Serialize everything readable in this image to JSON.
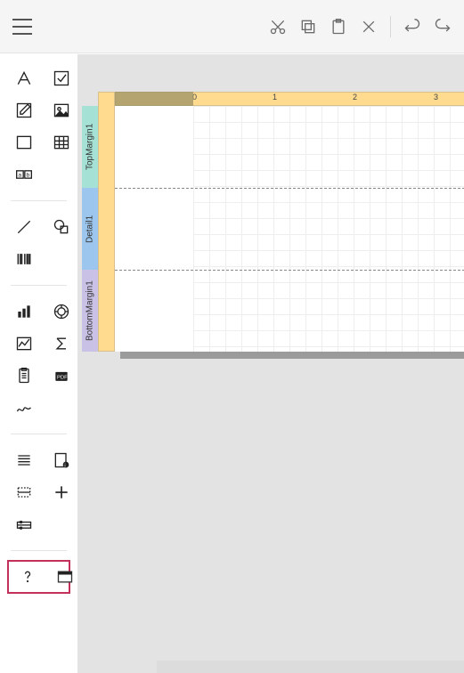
{
  "toolbar": {
    "cut": "Cut",
    "copy": "Copy",
    "paste": "Paste",
    "delete": "Delete",
    "undo": "Undo",
    "redo": "Redo"
  },
  "toolbox": {
    "groups": [
      [
        "label",
        "checkbox",
        "richtext",
        "picture",
        "panel",
        "table",
        "character-comb"
      ],
      [
        "line",
        "shape",
        "barcode"
      ],
      [
        "chart",
        "gauge",
        "sparkline",
        "sigma",
        "subreport",
        "pdf",
        "signature"
      ],
      [
        "toc",
        "page-info",
        "cross",
        "cross2",
        "pivot"
      ],
      [
        "help",
        "panel2"
      ]
    ]
  },
  "bands": {
    "top": "TopMargin1",
    "detail": "Detail1",
    "bottom": "BottomMargin1"
  },
  "ruler": {
    "marks": [
      "0",
      "1",
      "2",
      "3"
    ],
    "unit": "in"
  },
  "highlightedTool": "panel2"
}
